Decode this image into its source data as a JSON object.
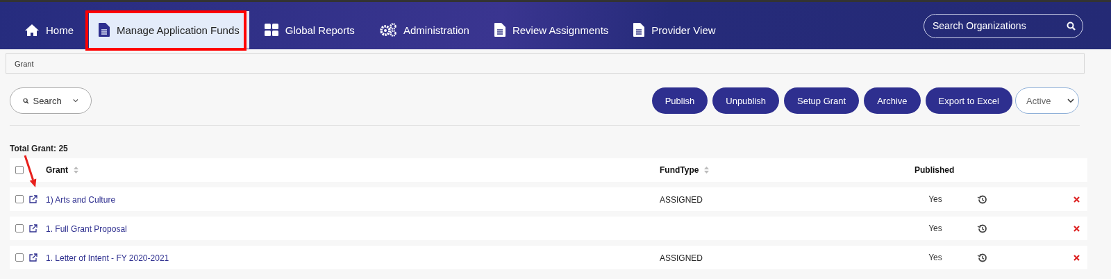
{
  "nav": {
    "items": [
      {
        "label": "Home",
        "kind": "home",
        "selected": false
      },
      {
        "label": "Manage Application Funds",
        "kind": "document",
        "selected": true
      },
      {
        "label": "Global Reports",
        "kind": "grid",
        "selected": false
      },
      {
        "label": "Administration",
        "kind": "gears",
        "selected": false
      },
      {
        "label": "Review Assignments",
        "kind": "document",
        "selected": false
      },
      {
        "label": "Provider View",
        "kind": "document",
        "selected": false
      }
    ],
    "search": {
      "placeholder": "Search Organizations"
    }
  },
  "breadcrumb": "Grant",
  "toolbar": {
    "search_button": "Search",
    "buttons": [
      "Publish",
      "Unpublish",
      "Setup Grant",
      "Archive",
      "Export to Excel"
    ],
    "status_select": "Active"
  },
  "total": "Total Grant: 25",
  "table": {
    "columns": [
      "Grant",
      "FundType",
      "Published"
    ],
    "header_checked": false,
    "rows": [
      {
        "grant": "1) Arts and Culture",
        "fund_type": "ASSIGNED",
        "published": "Yes",
        "checked": false
      },
      {
        "grant": "1. Full Grant Proposal",
        "published": "Yes",
        "checked": false
      },
      {
        "grant": "1. Letter of Intent - FY 2020-2021",
        "fund_type": "ASSIGNED",
        "published": "Yes",
        "checked": false
      }
    ]
  }
}
